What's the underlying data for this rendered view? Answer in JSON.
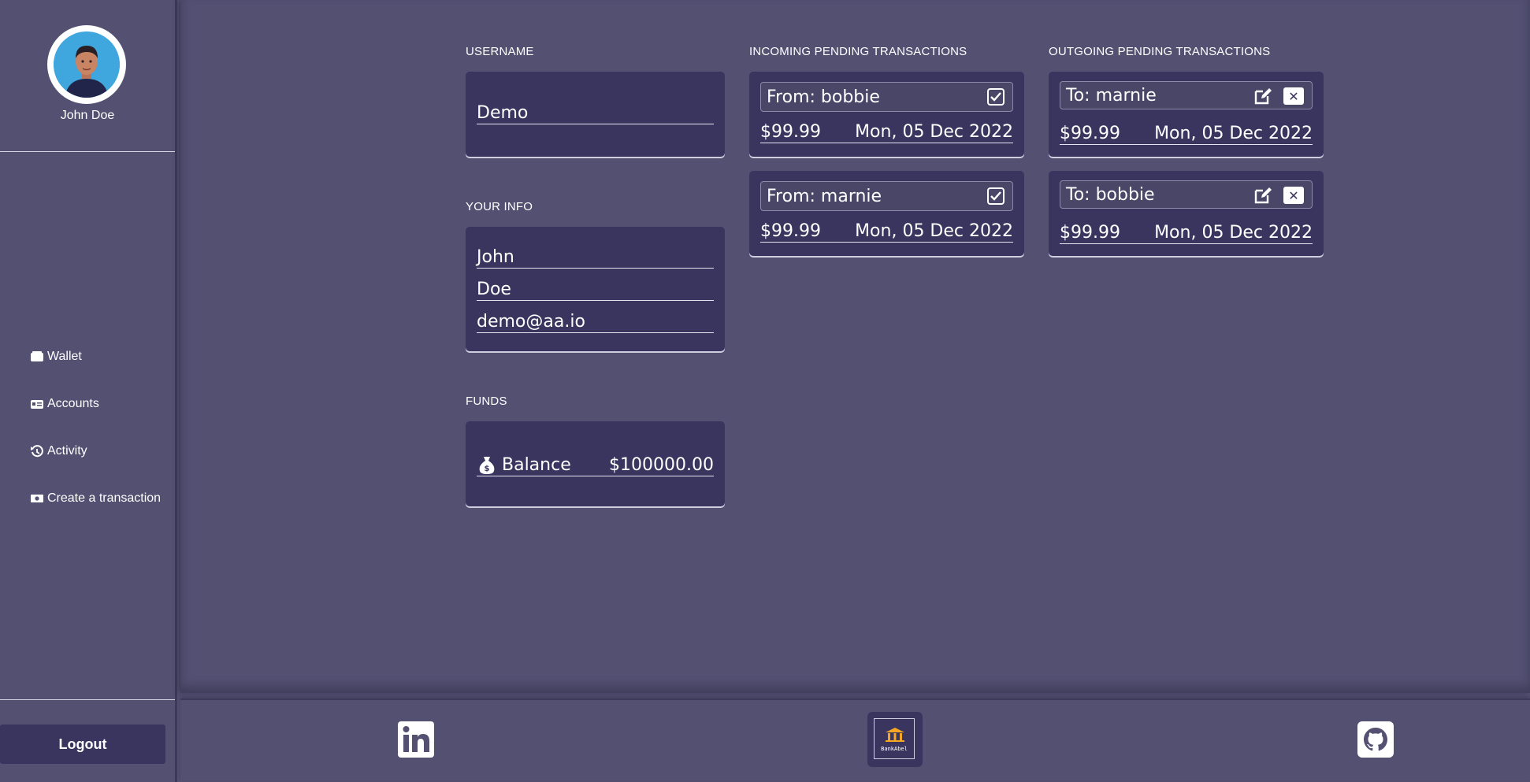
{
  "sidebar": {
    "user_name": "John Doe",
    "nav": [
      {
        "label": "Wallet",
        "icon": "wallet-icon"
      },
      {
        "label": "Accounts",
        "icon": "id-card-icon"
      },
      {
        "label": "Activity",
        "icon": "history-icon"
      },
      {
        "label": "Create a transaction",
        "icon": "money-bill-icon"
      }
    ],
    "logout_label": "Logout"
  },
  "username_section": {
    "title": "USERNAME",
    "value": "Demo"
  },
  "info_section": {
    "title": "YOUR INFO",
    "first_name": "John",
    "last_name": "Doe",
    "email": "demo@aa.io"
  },
  "funds_section": {
    "title": "FUNDS",
    "label": "Balance",
    "amount": "$100000.00"
  },
  "incoming": {
    "title": "INCOMING PENDING TRANSACTIONS",
    "items": [
      {
        "from": "From: bobbie",
        "amount": "$99.99",
        "date": "Mon, 05 Dec 2022"
      },
      {
        "from": "From: marnie",
        "amount": "$99.99",
        "date": "Mon, 05 Dec 2022"
      }
    ]
  },
  "outgoing": {
    "title": "OUTGOING PENDING TRANSACTIONS",
    "items": [
      {
        "to": "To: marnie",
        "amount": "$99.99",
        "date": "Mon, 05 Dec 2022"
      },
      {
        "to": "To: bobbie",
        "amount": "$99.99",
        "date": "Mon, 05 Dec 2022"
      }
    ]
  },
  "footer": {
    "logo_text": "BankAbel",
    "icons": [
      "linkedin-icon",
      "bank-logo-icon",
      "github-icon"
    ]
  },
  "colors": {
    "background": "#535072",
    "card": "#3a355f",
    "accent": "#f5a623"
  }
}
